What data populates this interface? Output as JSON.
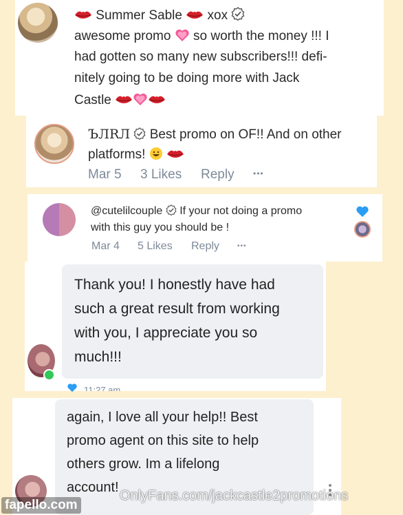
{
  "comment1": {
    "author": "Summer Sable",
    "author_suffix": "xox",
    "lines": [
      "awesome promo",
      "so worth the money !!! I",
      "had gotten so many new subscribers!!! defi-",
      "nitely going to be doing more with Jack",
      "Castle"
    ]
  },
  "reply1": {
    "author": "ЪЛRЛ",
    "text_line1": "Best promo on OF!! And on other",
    "text_line2": "platforms!",
    "date": "Mar 5",
    "likes": "3 Likes",
    "reply_label": "Reply",
    "more": "•••"
  },
  "reply2": {
    "author": "@cutelilcouple",
    "text_line1": "If your not doing a promo",
    "text_line2": "with this guy you should be !",
    "date": "Mar 4",
    "likes": "5 Likes",
    "reply_label": "Reply",
    "more": "•••"
  },
  "chat1": {
    "lines": [
      "Thank you! I honestly have had",
      "such a great result from working",
      "with you, I appreciate you so",
      "much!!!"
    ],
    "time": "11:27 am"
  },
  "chat2": {
    "lines": [
      "again, I love all your help!! Best",
      "promo agent on this site to help",
      "others grow. Im a lifelong",
      "account!"
    ]
  },
  "watermarks": {
    "site": "fapello.com",
    "onlyfans": "OnlyFans.com/jackcastle2promotions"
  },
  "colors": {
    "background": "#fdf0cf",
    "panel": "#ffffff",
    "bubble": "#eef0f3",
    "meta": "#7d8a99",
    "accent_blue": "#2a9df4",
    "online_green": "#34c759",
    "lips_red": "#d4202c",
    "heart_pink": "#f25c9a"
  }
}
